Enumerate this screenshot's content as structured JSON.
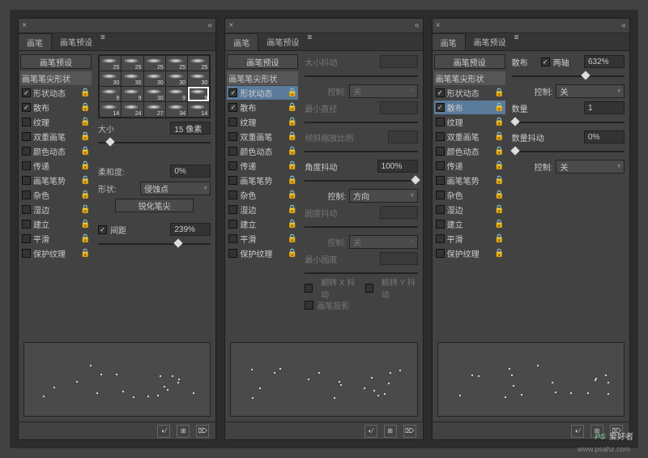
{
  "tabs": {
    "brush": "画笔",
    "preset": "画笔预设"
  },
  "sidebar": {
    "preset": "画笔预设",
    "tipshape": "画笔笔尖形状",
    "items": [
      {
        "label": "形状动态",
        "key": "shape"
      },
      {
        "label": "散布",
        "key": "scatter"
      },
      {
        "label": "纹理",
        "key": "texture"
      },
      {
        "label": "双重画笔",
        "key": "dual"
      },
      {
        "label": "颜色动态",
        "key": "color"
      },
      {
        "label": "传递",
        "key": "transfer"
      },
      {
        "label": "画笔笔势",
        "key": "pose"
      },
      {
        "label": "杂色",
        "key": "noise"
      },
      {
        "label": "湿边",
        "key": "wet"
      },
      {
        "label": "建立",
        "key": "build"
      },
      {
        "label": "平滑",
        "key": "smooth"
      },
      {
        "label": "保护纹理",
        "key": "protect"
      }
    ]
  },
  "p1": {
    "checked": {
      "shape": true,
      "scatter": true,
      "spacing": true
    },
    "swatches": [
      25,
      25,
      25,
      25,
      25,
      30,
      30,
      30,
      30,
      30,
      9,
      9,
      30,
      9,
      9,
      14,
      24,
      27,
      34,
      14
    ],
    "size_label": "大小",
    "size_value": "15 像素",
    "soft_label": "柔和度:",
    "soft_value": "0%",
    "shape_label": "形状:",
    "shape_value": "侵蚀点",
    "sharpen": "锐化笔尖",
    "spacing_label": "间距",
    "spacing_value": "239%"
  },
  "p2": {
    "checked": {
      "shape": true,
      "scatter": true
    },
    "tab_label": "大小抖动",
    "control": "控制:",
    "control_val": "关",
    "mindia": "最小直径",
    "tilt": "倾斜缩放比例",
    "angle": "角度抖动",
    "angle_val": "100%",
    "control2_val": "方向",
    "round": "圆度抖动",
    "control3_val": "关",
    "minround": "最小圆度",
    "flipx": "翻转 X 抖动",
    "flipy": "翻转 Y 抖动",
    "proj": "画笔投影"
  },
  "p3": {
    "checked": {
      "shape": true,
      "scatter": true,
      "bothaxes": true
    },
    "scatter_label": "散布",
    "bothaxes": "两轴",
    "scatter_val": "632%",
    "control": "控制:",
    "control_val": "关",
    "count_label": "数量",
    "count_val": "1",
    "countjit_label": "数量抖动",
    "countjit_val": "0%",
    "control2_val": "关"
  },
  "watermark": {
    "brand": "PS",
    "text": "爱好者",
    "url": "www.psahz.com"
  }
}
